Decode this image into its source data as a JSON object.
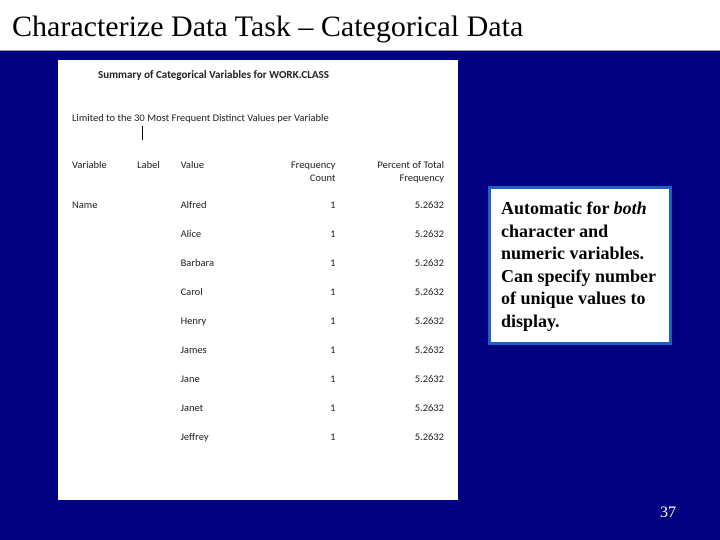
{
  "title": "Characterize Data Task – Categorical Data",
  "summary_heading": "Summary of Categorical Variables for WORK.CLASS",
  "limited_text": "Limited to the 30 Most Frequent Distinct Values per Variable",
  "columns": {
    "c1": "Variable",
    "c2": "Label",
    "c3": "Value",
    "c4a": "Frequency",
    "c4b": "Count",
    "c5a": "Percent of Total",
    "c5b": "Frequency"
  },
  "rows": [
    {
      "variable": "Name",
      "label": "",
      "value": "Alfred",
      "count": "1",
      "pct": "5.2632"
    },
    {
      "variable": "",
      "label": "",
      "value": "Alice",
      "count": "1",
      "pct": "5.2632"
    },
    {
      "variable": "",
      "label": "",
      "value": "Barbara",
      "count": "1",
      "pct": "5.2632"
    },
    {
      "variable": "",
      "label": "",
      "value": "Carol",
      "count": "1",
      "pct": "5.2632"
    },
    {
      "variable": "",
      "label": "",
      "value": "Henry",
      "count": "1",
      "pct": "5.2632"
    },
    {
      "variable": "",
      "label": "",
      "value": "James",
      "count": "1",
      "pct": "5.2632"
    },
    {
      "variable": "",
      "label": "",
      "value": "Jane",
      "count": "1",
      "pct": "5.2632"
    },
    {
      "variable": "",
      "label": "",
      "value": "Janet",
      "count": "1",
      "pct": "5.2632"
    },
    {
      "variable": "",
      "label": "",
      "value": "Jeffrey",
      "count": "1",
      "pct": "5.2632"
    }
  ],
  "callout": {
    "t1": "Automatic for ",
    "t2": "both",
    "t3": " character and numeric variables.  Can specify number of unique values to display."
  },
  "page_number": "37"
}
